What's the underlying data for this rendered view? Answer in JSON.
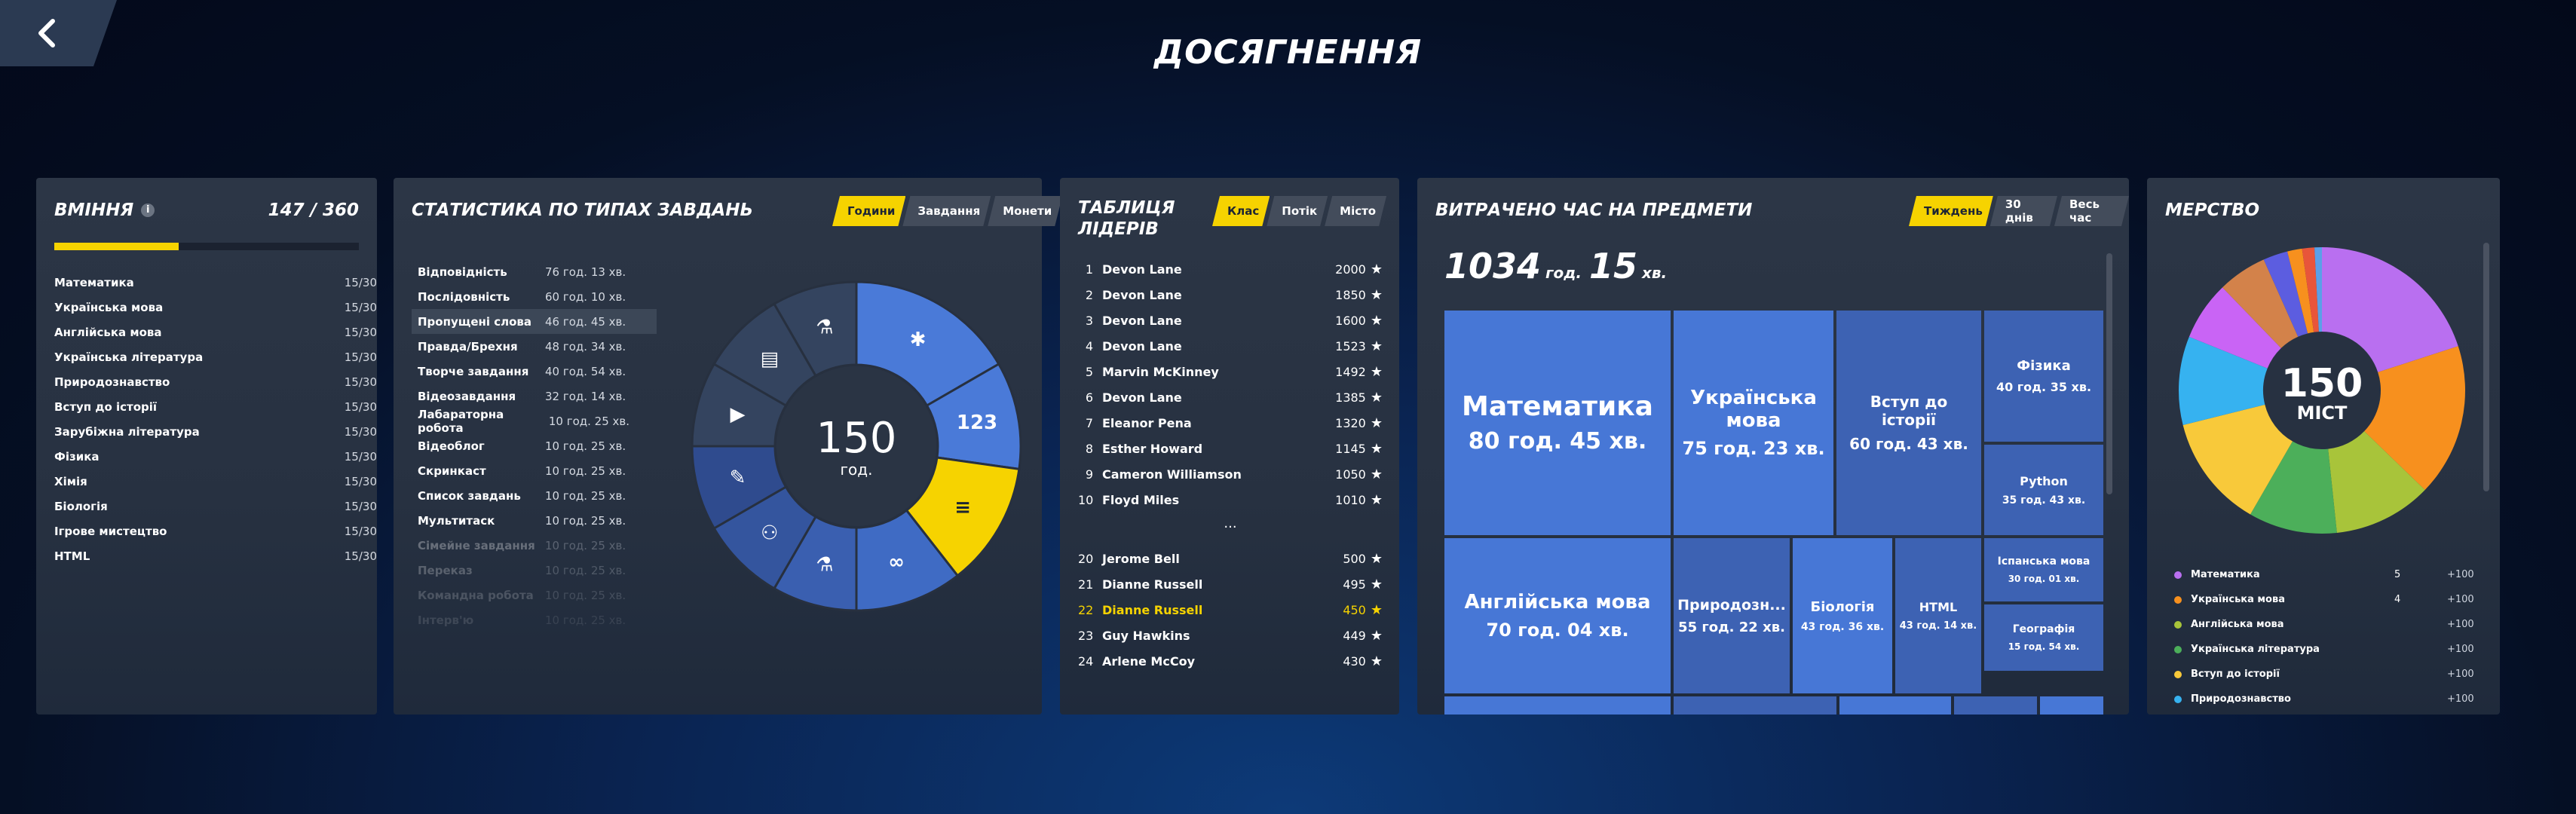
{
  "title": "ДОСЯГНЕННЯ",
  "skills": {
    "title": "ВМІННЯ",
    "score": "147 / 360",
    "progress": 0.408,
    "items": [
      {
        "label": "Математика",
        "value": "15/30"
      },
      {
        "label": "Українська мова",
        "value": "15/30"
      },
      {
        "label": "Англійська мова",
        "value": "15/30"
      },
      {
        "label": "Українська література",
        "value": "15/30"
      },
      {
        "label": "Природознавство",
        "value": "15/30"
      },
      {
        "label": "Вступ до історії",
        "value": "15/30"
      },
      {
        "label": "Зарубіжна література",
        "value": "15/30"
      },
      {
        "label": "Фізика",
        "value": "15/30"
      },
      {
        "label": "Хімія",
        "value": "15/30"
      },
      {
        "label": "Біологія",
        "value": "15/30"
      },
      {
        "label": "Ігрове мистецтво",
        "value": "15/30"
      },
      {
        "label": "HTML",
        "value": "15/30"
      }
    ]
  },
  "stats": {
    "title": "СТАТИСТИКА ПО ТИПАХ ЗАВДАНЬ",
    "tabs": [
      "Години",
      "Завдання",
      "Монети"
    ],
    "active_tab": 0,
    "items": [
      {
        "label": "Відповідність",
        "value": "76 год. 13 хв."
      },
      {
        "label": "Послідовність",
        "value": "60 год. 10 хв."
      },
      {
        "label": "Пропущені слова",
        "value": "46 год. 45 хв."
      },
      {
        "label": "Правда/Брехня",
        "value": "48 год. 34 хв."
      },
      {
        "label": "Творче завдання",
        "value": "40 год. 54 хв."
      },
      {
        "label": "Відеозавдання",
        "value": "32 год. 14 хв."
      },
      {
        "label": "Лабараторна робота",
        "value": "10 год. 25 хв."
      },
      {
        "label": "Відеоблог",
        "value": "10 год. 25 хв."
      },
      {
        "label": "Скринкаст",
        "value": "10 год. 25 хв."
      },
      {
        "label": "Список завдань",
        "value": "10 год. 25 хв."
      },
      {
        "label": "Мультитаск",
        "value": "10 год. 25 хв."
      },
      {
        "label": "Сімейне завдання",
        "value": "10 год. 25 хв."
      },
      {
        "label": "Переказ",
        "value": "10 год. 25 хв."
      },
      {
        "label": "Командна робота",
        "value": "10 год. 25 хв."
      },
      {
        "label": "Інтерв'ю",
        "value": "10 год. 25 хв."
      }
    ],
    "center_value": "150",
    "center_unit": "год."
  },
  "leaders": {
    "title_line1": "ТАБЛИЦЯ",
    "title_line2": "ЛІДЕРІВ",
    "tabs": [
      "Клас",
      "Потік",
      "Місто"
    ],
    "active_tab": 0,
    "top": [
      {
        "n": "1",
        "name": "Devon Lane",
        "score": "2000"
      },
      {
        "n": "2",
        "name": "Devon Lane",
        "score": "1850"
      },
      {
        "n": "3",
        "name": "Devon Lane",
        "score": "1600"
      },
      {
        "n": "4",
        "name": "Devon Lane",
        "score": "1523"
      },
      {
        "n": "5",
        "name": "Marvin McKinney",
        "score": "1492"
      },
      {
        "n": "6",
        "name": "Devon Lane",
        "score": "1385"
      },
      {
        "n": "7",
        "name": "Eleanor Pena",
        "score": "1320"
      },
      {
        "n": "8",
        "name": "Esther Howard",
        "score": "1145"
      },
      {
        "n": "9",
        "name": "Cameron Williamson",
        "score": "1050"
      },
      {
        "n": "10",
        "name": "Floyd Miles",
        "score": "1010"
      }
    ],
    "separator": "...",
    "bottom": [
      {
        "n": "20",
        "name": "Jerome Bell",
        "score": "500"
      },
      {
        "n": "21",
        "name": "Dianne Russell",
        "score": "495"
      },
      {
        "n": "22",
        "name": "Dianne Russell",
        "score": "450",
        "me": true
      },
      {
        "n": "23",
        "name": "Guy Hawkins",
        "score": "449"
      },
      {
        "n": "24",
        "name": "Arlene McCoy",
        "score": "430"
      }
    ]
  },
  "time": {
    "title": "ВИТРАЧЕНО ЧАС НА ПРЕДМЕТИ",
    "tabs": [
      "Тиждень",
      "30 днів",
      "Весь час"
    ],
    "active_tab": 0,
    "total_h": "1034",
    "unit_h": "год.",
    "total_m": "15",
    "unit_m": "хв.",
    "tiles": [
      {
        "name": "Математика",
        "value": "80 год. 45 хв."
      },
      {
        "name": "Українська мова",
        "value": "75 год. 23 хв."
      },
      {
        "name": "Вступ до історії",
        "value": "60 год. 43 хв."
      },
      {
        "name": "Фізика",
        "value": "40 год. 35 хв."
      },
      {
        "name": "Python",
        "value": "35 год. 43 хв."
      },
      {
        "name": "Англійська мова",
        "value": "70 год. 04 хв."
      },
      {
        "name": "Природозн...",
        "value": "55 год. 22 хв."
      },
      {
        "name": "Біологія",
        "value": "43 год. 36 хв."
      },
      {
        "name": "HTML",
        "value": "43 год. 14 хв."
      },
      {
        "name": "Іспанська мова",
        "value": "30 год. 01 хв."
      },
      {
        "name": "Географія",
        "value": "15 год. 54 хв."
      }
    ]
  },
  "rank": {
    "title": "МЕРСТВО",
    "center_value": "150",
    "center_label": "МІСТ",
    "legend": [
      {
        "name": "Математика",
        "count": "5",
        "pts": "+100",
        "color": "#b96ff0"
      },
      {
        "name": "Українська мова",
        "count": "4",
        "pts": "+100",
        "color": "#f7901e"
      },
      {
        "name": "Англійська мова",
        "count": "",
        "pts": "+100",
        "color": "#a8c43a"
      },
      {
        "name": "Українська література",
        "count": "",
        "pts": "+100",
        "color": "#4caf5a"
      },
      {
        "name": "Вступ до історії",
        "count": "",
        "pts": "+100",
        "color": "#f8c93a"
      },
      {
        "name": "Природознавство",
        "count": "",
        "pts": "+100",
        "color": "#36b2f0"
      }
    ]
  }
}
